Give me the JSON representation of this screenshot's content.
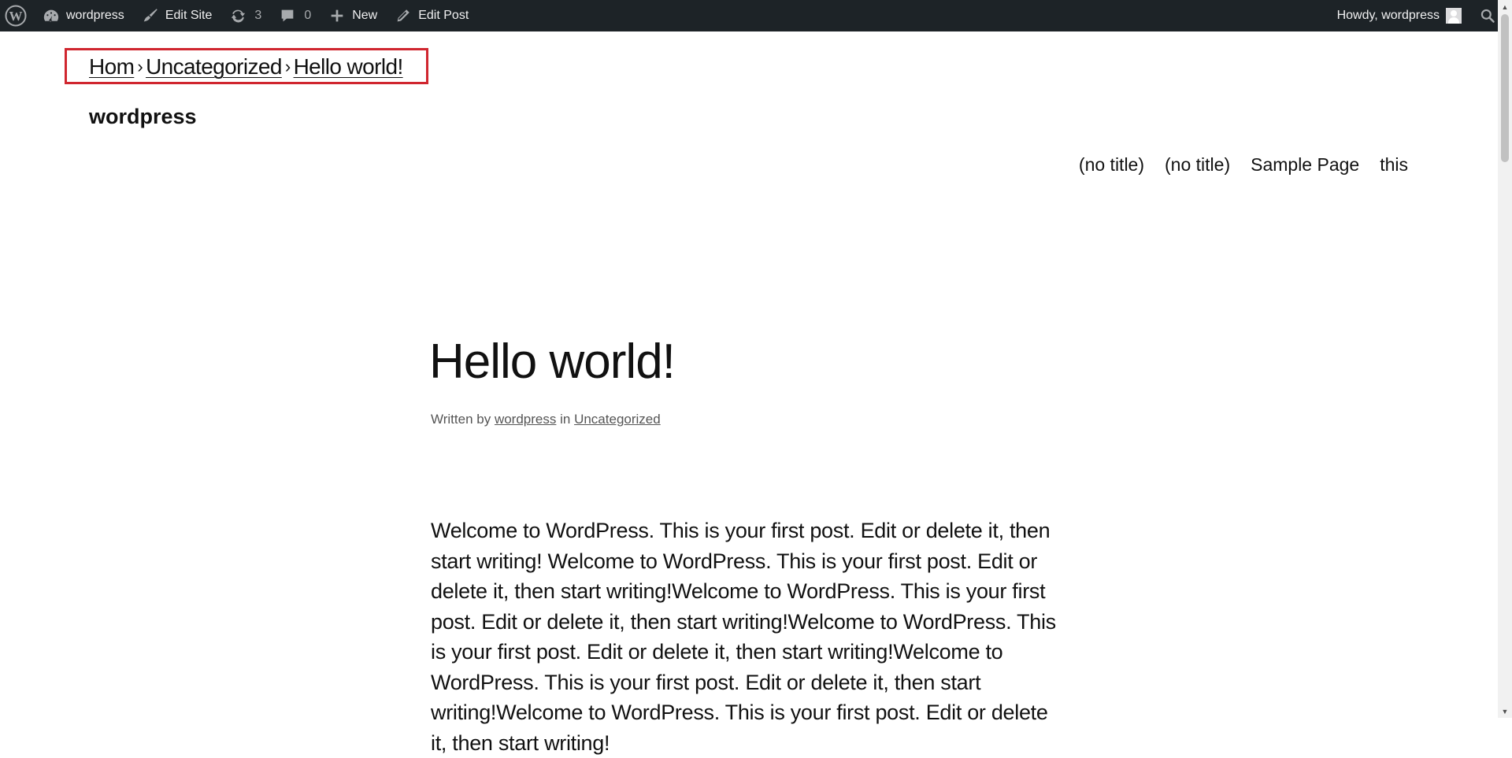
{
  "admin_bar": {
    "site_name": "wordpress",
    "edit_site": "Edit Site",
    "updates_count": "3",
    "comments_count": "0",
    "new_label": "New",
    "edit_post": "Edit Post",
    "howdy": "Howdy, wordpress",
    "icons": {
      "logo": "wordpress-logo-icon",
      "dashboard": "dashboard-icon",
      "edit_site": "brush-icon",
      "updates": "update-icon",
      "comments": "comment-icon",
      "new": "plus-icon",
      "edit_post": "pencil-icon",
      "search": "search-icon"
    }
  },
  "breadcrumb": {
    "items": [
      "Hom",
      "Uncategorized",
      "Hello world!"
    ],
    "separator": "›",
    "highlight_color": "#d0262f"
  },
  "site": {
    "title": "wordpress"
  },
  "nav": {
    "items": [
      "(no title)",
      "(no title)",
      "Sample Page",
      "this"
    ]
  },
  "post": {
    "title": "Hello world!",
    "meta_written_by": "Written by",
    "meta_author": "wordpress",
    "meta_in": "in",
    "meta_category": "Uncategorized",
    "content": "Welcome to WordPress. This is your first post. Edit or delete it, then start writing! Welcome to WordPress. This is your first post. Edit or delete it, then start writing!Welcome to WordPress. This is your first post. Edit or delete it, then start writing!Welcome to WordPress. This is your first post. Edit or delete it, then start writing!Welcome to WordPress. This is your first post. Edit or delete it, then start writing!Welcome to WordPress. This is your first post. Edit or delete it, then start writing!"
  }
}
